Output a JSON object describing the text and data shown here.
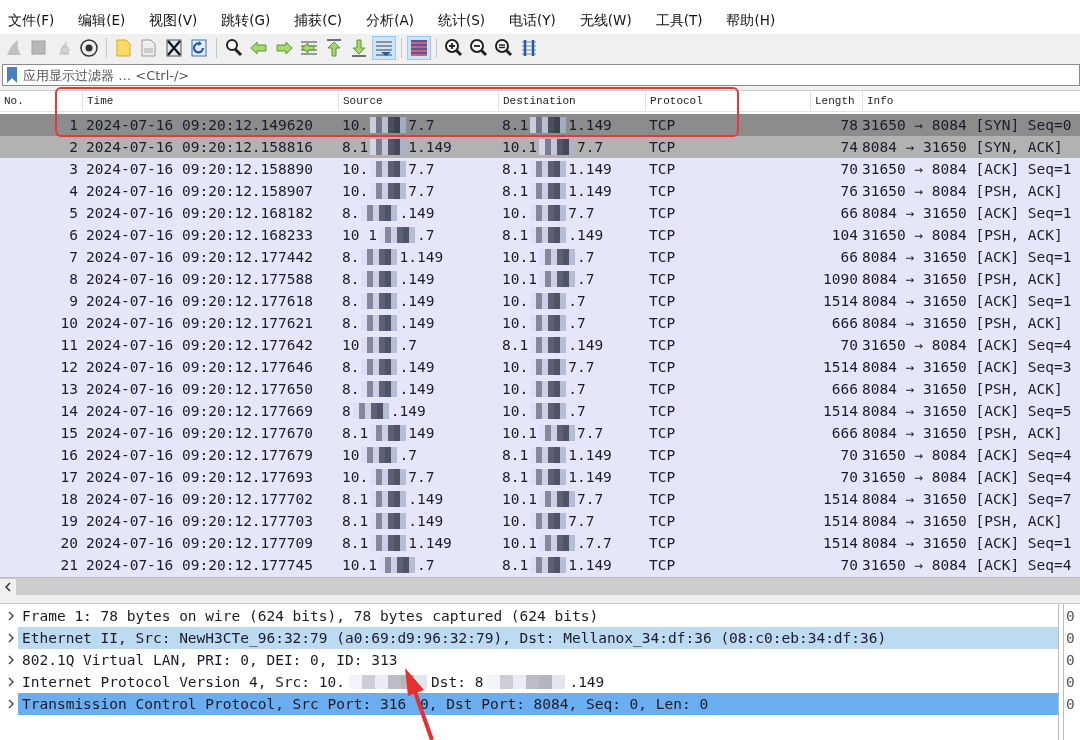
{
  "menu": [
    {
      "label": "文件(F)"
    },
    {
      "label": "编辑(E)"
    },
    {
      "label": "视图(V)"
    },
    {
      "label": "跳转(G)"
    },
    {
      "label": "捕获(C)"
    },
    {
      "label": "分析(A)"
    },
    {
      "label": "统计(S)"
    },
    {
      "label": "电话(Y)"
    },
    {
      "label": "无线(W)"
    },
    {
      "label": "工具(T)"
    },
    {
      "label": "帮助(H)"
    }
  ],
  "toolbar": [
    {
      "kind": "shark",
      "disabled": true,
      "pressed": false
    },
    {
      "kind": "stop",
      "disabled": true,
      "pressed": false
    },
    {
      "kind": "restart",
      "disabled": true,
      "pressed": false
    },
    {
      "kind": "options",
      "disabled": false,
      "pressed": false
    },
    {
      "kind": "separator"
    },
    {
      "kind": "open",
      "disabled": false,
      "pressed": false
    },
    {
      "kind": "save",
      "disabled": false,
      "pressed": false
    },
    {
      "kind": "close",
      "disabled": false,
      "pressed": false
    },
    {
      "kind": "reload",
      "disabled": false,
      "pressed": false
    },
    {
      "kind": "separator"
    },
    {
      "kind": "find",
      "disabled": false,
      "pressed": false
    },
    {
      "kind": "back",
      "disabled": false,
      "pressed": false
    },
    {
      "kind": "forward",
      "disabled": false,
      "pressed": false
    },
    {
      "kind": "goto",
      "disabled": false,
      "pressed": false
    },
    {
      "kind": "first",
      "disabled": false,
      "pressed": false
    },
    {
      "kind": "last",
      "disabled": false,
      "pressed": false
    },
    {
      "kind": "autoscroll",
      "disabled": false,
      "pressed": true
    },
    {
      "kind": "separator"
    },
    {
      "kind": "colorize",
      "disabled": false,
      "pressed": true
    },
    {
      "kind": "separator"
    },
    {
      "kind": "zoomin",
      "disabled": false,
      "pressed": false
    },
    {
      "kind": "zoomout",
      "disabled": false,
      "pressed": false
    },
    {
      "kind": "zoomreset",
      "disabled": false,
      "pressed": false
    },
    {
      "kind": "resize",
      "disabled": false,
      "pressed": false
    }
  ],
  "filter": {
    "placeholder": "应用显示过滤器 … <Ctrl-/>"
  },
  "packet_list": {
    "columns": [
      "No.",
      "Time",
      "Source",
      "Destination",
      "Protocol",
      "Length",
      "Info"
    ],
    "rows": [
      {
        "no": "1",
        "time": "2024-07-16 09:20:12.149620",
        "source": [
          "10.",
          "7.7"
        ],
        "destination": [
          "8.1",
          "1.149"
        ],
        "protocol": "TCP",
        "length": "78",
        "info": "31650 → 8084 [SYN] Seq=0",
        "selected": true,
        "highlighted": false
      },
      {
        "no": "2",
        "time": "2024-07-16 09:20:12.158816",
        "source": [
          "8.1",
          "1.149"
        ],
        "destination": [
          "10.1",
          "7.7"
        ],
        "protocol": "TCP",
        "length": "74",
        "info": "8084 → 31650 [SYN, ACK]",
        "selected": false,
        "highlighted": true
      },
      {
        "no": "3",
        "time": "2024-07-16 09:20:12.158890",
        "source": [
          "10.",
          "7.7"
        ],
        "destination": [
          "8.1",
          "1.149"
        ],
        "protocol": "TCP",
        "length": "70",
        "info": "31650 → 8084 [ACK] Seq=1",
        "selected": false,
        "highlighted": false
      },
      {
        "no": "4",
        "time": "2024-07-16 09:20:12.158907",
        "source": [
          "10.",
          "7.7"
        ],
        "destination": [
          "8.1",
          "1.149"
        ],
        "protocol": "TCP",
        "length": "76",
        "info": "31650 → 8084 [PSH, ACK]",
        "selected": false,
        "highlighted": false
      },
      {
        "no": "5",
        "time": "2024-07-16 09:20:12.168182",
        "source": [
          "8.",
          ".149"
        ],
        "destination": [
          "10.",
          "7.7"
        ],
        "protocol": "TCP",
        "length": "66",
        "info": "8084 → 31650 [ACK] Seq=1",
        "selected": false,
        "highlighted": false
      },
      {
        "no": "6",
        "time": "2024-07-16 09:20:12.168233",
        "source": [
          "10 1",
          ".7"
        ],
        "destination": [
          "8.1",
          ".149"
        ],
        "protocol": "TCP",
        "length": "104",
        "info": "31650 → 8084 [PSH, ACK]",
        "selected": false,
        "highlighted": false
      },
      {
        "no": "7",
        "time": "2024-07-16 09:20:12.177442",
        "source": [
          "8.",
          "1.149"
        ],
        "destination": [
          "10.1",
          ".7"
        ],
        "protocol": "TCP",
        "length": "66",
        "info": "8084 → 31650 [ACK] Seq=1",
        "selected": false,
        "highlighted": false
      },
      {
        "no": "8",
        "time": "2024-07-16 09:20:12.177588",
        "source": [
          "8.",
          ".149"
        ],
        "destination": [
          "10.1",
          ".7"
        ],
        "protocol": "TCP",
        "length": "1090",
        "info": "8084 → 31650 [PSH, ACK]",
        "selected": false,
        "highlighted": false
      },
      {
        "no": "9",
        "time": "2024-07-16 09:20:12.177618",
        "source": [
          "8.",
          ".149"
        ],
        "destination": [
          "10.",
          ".7"
        ],
        "protocol": "TCP",
        "length": "1514",
        "info": "8084 → 31650 [ACK] Seq=1",
        "selected": false,
        "highlighted": false
      },
      {
        "no": "10",
        "time": "2024-07-16 09:20:12.177621",
        "source": [
          "8.",
          ".149"
        ],
        "destination": [
          "10.",
          ".7"
        ],
        "protocol": "TCP",
        "length": "666",
        "info": "8084 → 31650 [PSH, ACK]",
        "selected": false,
        "highlighted": false
      },
      {
        "no": "11",
        "time": "2024-07-16 09:20:12.177642",
        "source": [
          "10",
          ".7"
        ],
        "destination": [
          "8.1",
          ".149"
        ],
        "protocol": "TCP",
        "length": "70",
        "info": "31650 → 8084 [ACK] Seq=4",
        "selected": false,
        "highlighted": false
      },
      {
        "no": "12",
        "time": "2024-07-16 09:20:12.177646",
        "source": [
          "8.",
          ".149"
        ],
        "destination": [
          "10.",
          "7.7"
        ],
        "protocol": "TCP",
        "length": "1514",
        "info": "8084 → 31650 [ACK] Seq=3",
        "selected": false,
        "highlighted": false
      },
      {
        "no": "13",
        "time": "2024-07-16 09:20:12.177650",
        "source": [
          "8.",
          ".149"
        ],
        "destination": [
          "10.",
          ".7"
        ],
        "protocol": "TCP",
        "length": "666",
        "info": "8084 → 31650 [PSH, ACK]",
        "selected": false,
        "highlighted": false
      },
      {
        "no": "14",
        "time": "2024-07-16 09:20:12.177669",
        "source": [
          "8",
          ".149"
        ],
        "destination": [
          "10.",
          ".7"
        ],
        "protocol": "TCP",
        "length": "1514",
        "info": "8084 → 31650 [ACK] Seq=5",
        "selected": false,
        "highlighted": false
      },
      {
        "no": "15",
        "time": "2024-07-16 09:20:12.177670",
        "source": [
          "8.1",
          "149"
        ],
        "destination": [
          "10.1",
          "7.7"
        ],
        "protocol": "TCP",
        "length": "666",
        "info": "8084 → 31650 [PSH, ACK]",
        "selected": false,
        "highlighted": false
      },
      {
        "no": "16",
        "time": "2024-07-16 09:20:12.177679",
        "source": [
          "10",
          ".7"
        ],
        "destination": [
          "8.1",
          "1.149"
        ],
        "protocol": "TCP",
        "length": "70",
        "info": "31650 → 8084 [ACK] Seq=4",
        "selected": false,
        "highlighted": false
      },
      {
        "no": "17",
        "time": "2024-07-16 09:20:12.177693",
        "source": [
          "10.",
          "7.7"
        ],
        "destination": [
          "8.1",
          "1.149"
        ],
        "protocol": "TCP",
        "length": "70",
        "info": "31650 → 8084 [ACK] Seq=4",
        "selected": false,
        "highlighted": false
      },
      {
        "no": "18",
        "time": "2024-07-16 09:20:12.177702",
        "source": [
          "8.1",
          ".149"
        ],
        "destination": [
          "10.1",
          "7.7"
        ],
        "protocol": "TCP",
        "length": "1514",
        "info": "8084 → 31650 [ACK] Seq=7",
        "selected": false,
        "highlighted": false
      },
      {
        "no": "19",
        "time": "2024-07-16 09:20:12.177703",
        "source": [
          "8.1",
          ".149"
        ],
        "destination": [
          "10.",
          "7.7"
        ],
        "protocol": "TCP",
        "length": "1514",
        "info": "8084 → 31650 [PSH, ACK]",
        "selected": false,
        "highlighted": false
      },
      {
        "no": "20",
        "time": "2024-07-16 09:20:12.177709",
        "source": [
          "8.1",
          "1.149"
        ],
        "destination": [
          "10.1",
          ".7.7"
        ],
        "protocol": "TCP",
        "length": "1514",
        "info": "8084 → 31650 [ACK] Seq=1",
        "selected": false,
        "highlighted": false
      },
      {
        "no": "21",
        "time": "2024-07-16 09:20:12.177745",
        "source": [
          "10.1",
          ".7"
        ],
        "destination": [
          "8.1",
          "1.149"
        ],
        "protocol": "TCP",
        "length": "70",
        "info": "31650 → 8084 [ACK] Seq=4",
        "selected": false,
        "highlighted": false
      }
    ]
  },
  "details": [
    {
      "parts": [
        "Frame 1: 78 bytes on wire (624 bits), 78 bytes captured (624 bits)"
      ],
      "expanded": false,
      "selected": false,
      "highlighted": false
    },
    {
      "parts": [
        "Ethernet II, Src: NewH3CTe_96:32:79 (a0:69:d9:96:32:79), Dst: Mellanox_34:df:36 (08:c0:eb:34:df:36)"
      ],
      "expanded": false,
      "selected": false,
      "highlighted": true
    },
    {
      "parts": [
        "802.1Q Virtual LAN, PRI: 0, DEI: 0, ID: 313"
      ],
      "expanded": false,
      "selected": false,
      "highlighted": false
    },
    {
      "parts": [
        "Internet Protocol Version 4, Src: 10.",
        "Dst: 8",
        ".149"
      ],
      "expanded": false,
      "selected": false,
      "highlighted": false
    },
    {
      "parts": [
        "Transmission Control Protocol, Src Port: 316",
        "0, Dst Port: 8084, Seq: 0, Len: 0"
      ],
      "expanded": false,
      "selected": true,
      "highlighted": false
    }
  ],
  "hex_pane": [
    "0",
    "0",
    "0",
    "0",
    "0"
  ]
}
